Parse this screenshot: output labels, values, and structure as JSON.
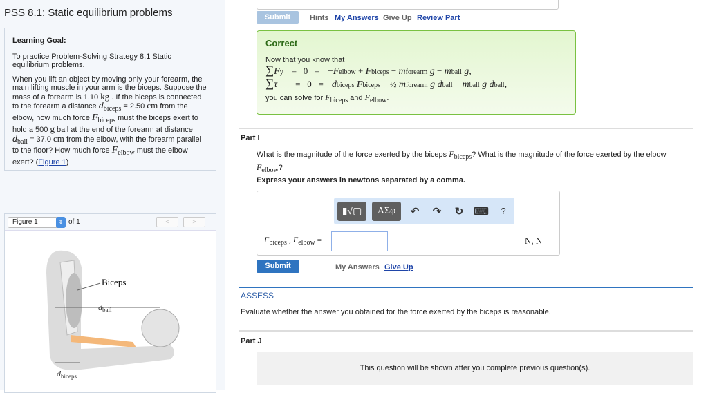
{
  "title": "PSS 8.1: Static equilibrium problems",
  "goal": {
    "heading": "Learning Goal:",
    "intro": "To practice Problem-Solving Strategy 8.1 Static equilibrium problems.",
    "p1": "When you lift an object by moving only your forearm, the main lifting muscle in your arm is the biceps. Suppose the mass of a forearm is 1.10",
    "kg": "kg",
    "p2": ". If the biceps is connected to the forearm a distance",
    "dbiceps_val": "= 2.50",
    "cm": "cm",
    "p3": "from the elbow, how much force",
    "p4": "must the biceps exert to hold a 500",
    "g": "g",
    "p5": "ball at the end of the forearm at distance",
    "dball_val": "= 37.0",
    "p6": "from the elbow, with the forearm parallel to the floor? How much force",
    "p7": "must the elbow exert? (",
    "link": "Figure 1",
    "p8": ")"
  },
  "figure": {
    "select": "Figure 1",
    "of": "of 1",
    "prev": "<",
    "next": ">",
    "label_biceps": "Biceps",
    "label_dball": "d",
    "label_dball_sub": "ball",
    "label_dbiceps": "d",
    "label_dbiceps_sub": "biceps"
  },
  "sym": {
    "F": "F",
    "d": "d",
    "m": "m",
    "g": "g",
    "tau": "τ",
    "sigma": "∑",
    "biceps": "biceps",
    "elbow": "elbow",
    "ball": "ball",
    "forearm": "forearm",
    "y": "y"
  },
  "toolbar_top": {
    "submit": "Submit",
    "hints": "Hints",
    "my_answers": "My Answers",
    "give_up": "Give Up",
    "review": "Review Part"
  },
  "correct": {
    "heading": "Correct",
    "intro": "Now that you know that",
    "outro1": "you can solve for",
    "and": "and",
    "end": "."
  },
  "partI": {
    "label": "Part I",
    "q1": "What is the magnitude of the force exerted by the biceps",
    "q2": "? What is the magnitude of the force exerted by the elbow",
    "q3": "?",
    "express": "Express your answers in newtons separated by a comma.",
    "tb": {
      "templates": "▮√▢",
      "greek": "ΑΣφ",
      "undo": "↶",
      "redo": "↷",
      "reset": "↻",
      "keyboard": "⌨",
      "help": "?"
    },
    "eq_sign": "=",
    "units": "N, N",
    "answer": "",
    "submit": "Submit",
    "my_answers": "My Answers",
    "give_up": "Give Up"
  },
  "assess": {
    "label": "ASSESS",
    "text": "Evaluate whether the answer you obtained for the force exerted by the biceps is reasonable."
  },
  "partJ": {
    "label": "Part J",
    "text": "This question will be shown after you complete previous question(s)."
  }
}
